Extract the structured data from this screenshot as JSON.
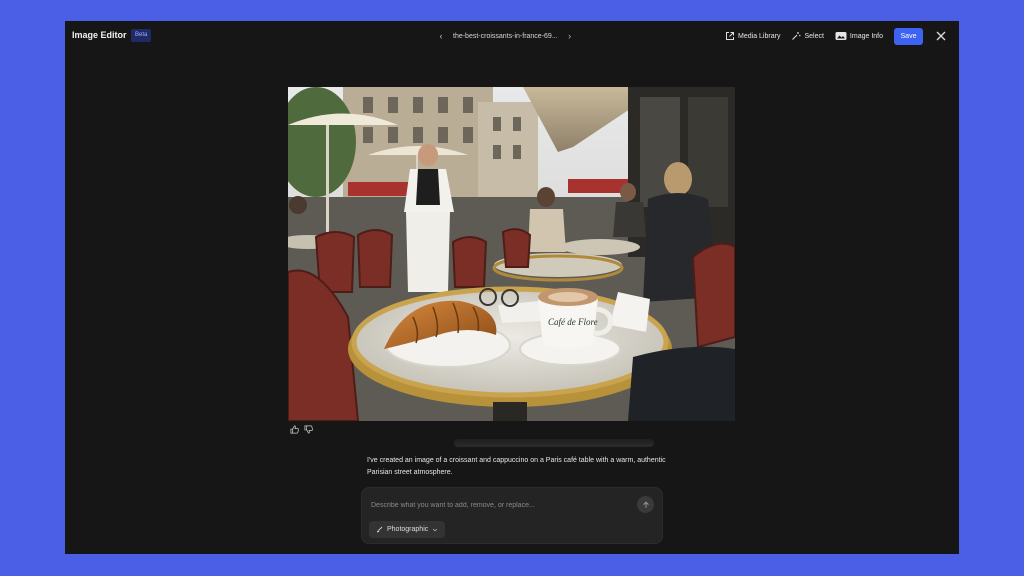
{
  "header": {
    "title": "Image Editor",
    "badge": "Beta",
    "filename": "the-best-croissants-in-france-69...",
    "tools": {
      "media_library": "Media Library",
      "select": "Select",
      "image_info": "Image Info",
      "save": "Save"
    }
  },
  "icons": {
    "prev": "chevron-left-icon",
    "next": "chevron-right-icon",
    "media_library": "external-link-icon",
    "select": "select-wand-icon",
    "image_info": "image-info-icon",
    "close": "close-icon",
    "like": "thumbs-up-icon",
    "dislike": "thumbs-down-icon",
    "send": "arrow-up-icon",
    "style": "brush-icon"
  },
  "assistant": {
    "message": "I've created an image of a croissant and cappuccino on a Paris café table with a warm, authentic Parisian street atmosphere."
  },
  "composer": {
    "placeholder": "Describe what you want to add, remove, or replace...",
    "style_label": "Photographic"
  },
  "image": {
    "cup_text": "Café de Flore"
  },
  "colors": {
    "accent": "#3e63f2",
    "background": "#4a5fe6",
    "app": "#161616"
  }
}
